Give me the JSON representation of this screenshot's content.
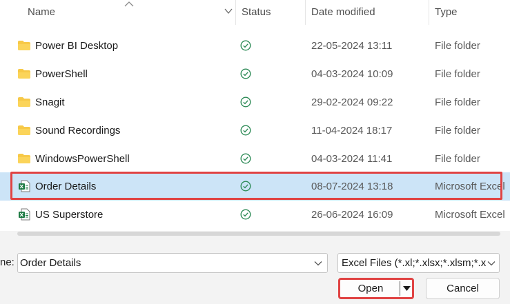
{
  "columns": {
    "name": "Name",
    "status": "Status",
    "date_modified": "Date modified",
    "type": "Type"
  },
  "files": [
    {
      "name": "Power BI Desktop",
      "icon": "folder-icon",
      "status": "synced",
      "date": "22-05-2024 13:11",
      "type": "File folder",
      "selected": false
    },
    {
      "name": "PowerShell",
      "icon": "folder-icon",
      "status": "synced",
      "date": "04-03-2024 10:09",
      "type": "File folder",
      "selected": false
    },
    {
      "name": "Snagit",
      "icon": "folder-icon",
      "status": "synced",
      "date": "29-02-2024 09:22",
      "type": "File folder",
      "selected": false
    },
    {
      "name": "Sound Recordings",
      "icon": "folder-icon",
      "status": "synced",
      "date": "11-04-2024 18:17",
      "type": "File folder",
      "selected": false
    },
    {
      "name": "WindowsPowerShell",
      "icon": "folder-icon",
      "status": "synced",
      "date": "04-03-2024 11:41",
      "type": "File folder",
      "selected": false
    },
    {
      "name": "Order Details",
      "icon": "excel-file-icon",
      "status": "synced",
      "date": "08-07-2024 13:18",
      "type": "Microsoft Excel",
      "selected": true
    },
    {
      "name": "US Superstore",
      "icon": "excel-file-icon",
      "status": "synced",
      "date": "26-06-2024 16:09",
      "type": "Microsoft Excel",
      "selected": false
    }
  ],
  "filename": {
    "label": "ne:",
    "value": "Order Details"
  },
  "filter": {
    "value": "Excel Files (*.xl;*.xlsx;*.xlsm;*.xlsb"
  },
  "buttons": {
    "open": "Open",
    "cancel": "Cancel"
  },
  "colors": {
    "selection": "#cce4f7",
    "highlight_outline": "#e04343",
    "status_green": "#2e8b57",
    "folder": "#f7c948",
    "excel": "#1d7a43"
  }
}
